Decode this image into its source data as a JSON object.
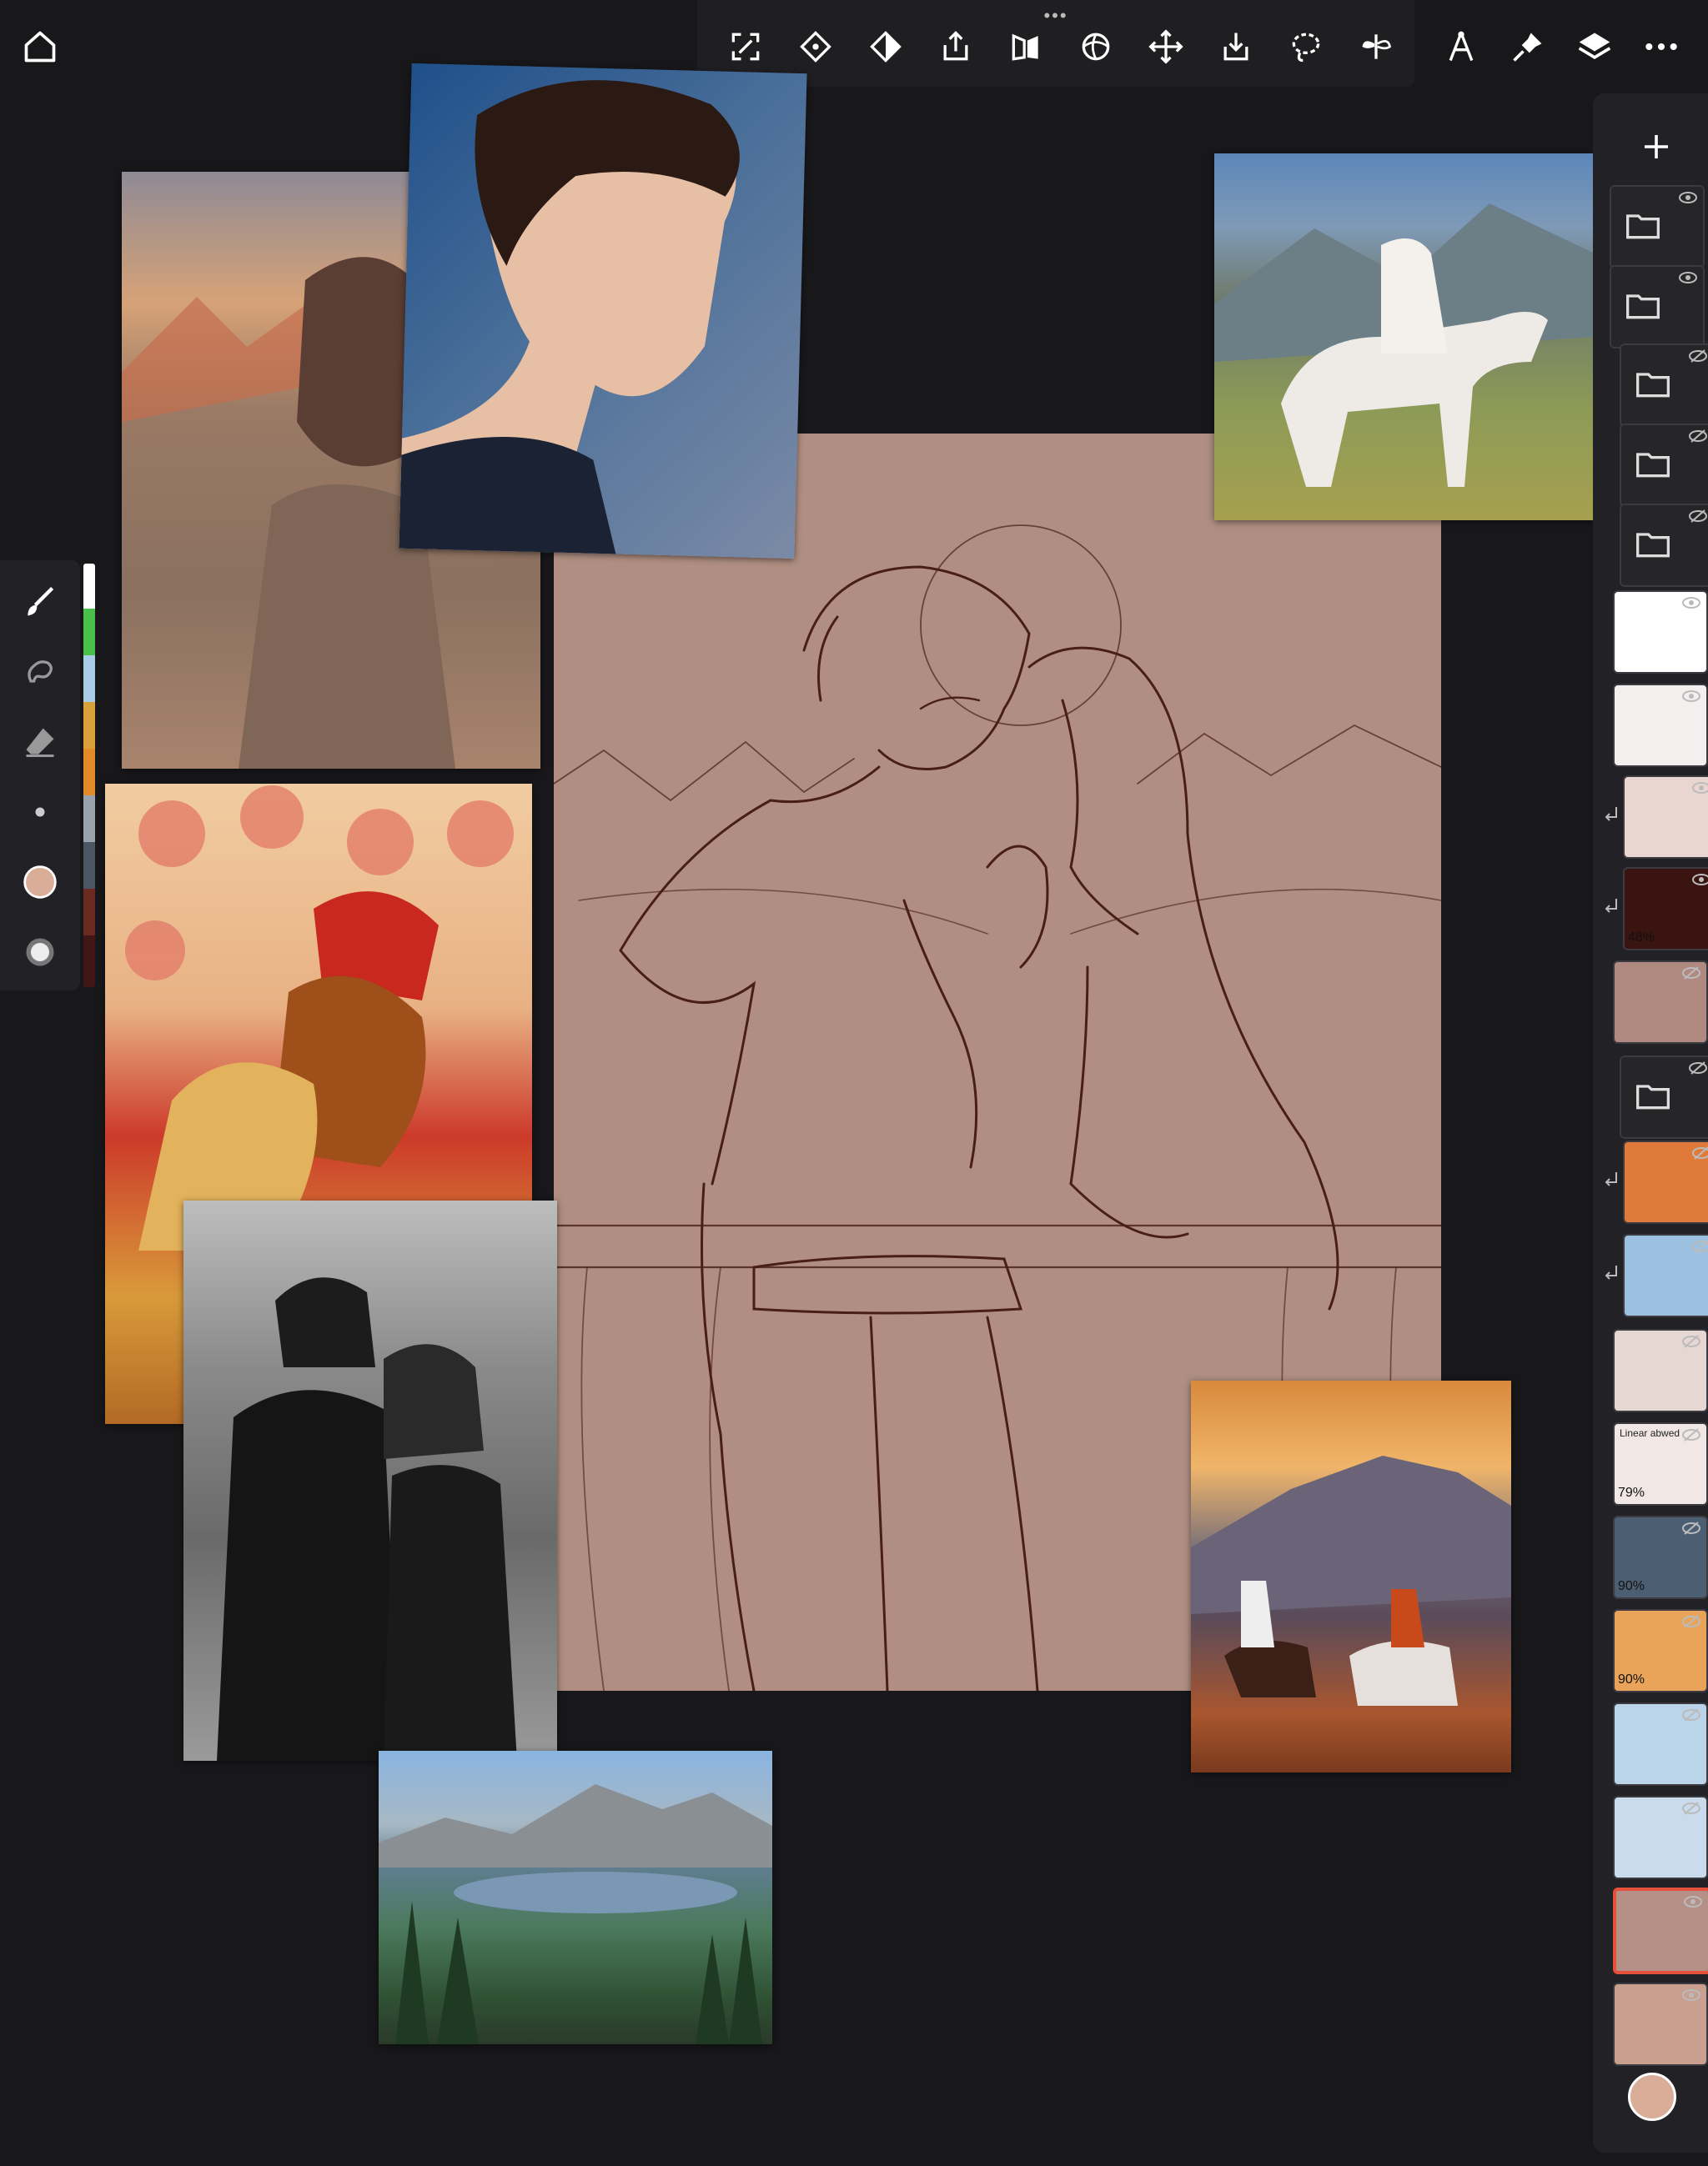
{
  "app": {
    "toolbar_grip": "•••",
    "top_icons": [
      "home-icon",
      "transform-icon",
      "selection-fill-icon",
      "bucket-fill-icon",
      "export-icon",
      "symmetry-icon",
      "perspective-icon",
      "move-icon",
      "import-icon",
      "lasso-icon",
      "mirror-icon",
      "ruler-icon",
      "pin-icon",
      "layers-icon",
      "more-icon"
    ]
  },
  "brush_tools": [
    "brush-icon",
    "smudge-icon",
    "eraser-icon",
    "size-dot-icon",
    "color-swatch-icon",
    "opacity-icon"
  ],
  "swatch_colors": [
    "#ffffff",
    "#48c04a",
    "#a9cde6",
    "#d9a13a",
    "#e08a2a",
    "#9aa3ad",
    "#4a5663",
    "#6b2a20",
    "#401616"
  ],
  "layers": {
    "items": [
      {
        "type": "folder",
        "visible": true
      },
      {
        "type": "folder",
        "visible": true
      },
      {
        "type": "folder",
        "visible": false
      },
      {
        "type": "folder",
        "visible": false
      },
      {
        "type": "folder",
        "visible": false
      },
      {
        "type": "image",
        "visible": true,
        "color": "#ffffff"
      },
      {
        "type": "image",
        "visible": true,
        "color": "#f2efee"
      },
      {
        "type": "image",
        "visible": true,
        "color": "#e9d6d0",
        "clipped": true
      },
      {
        "type": "image",
        "visible": true,
        "color": "#3a1410",
        "opacity": "48%",
        "clipped": true
      },
      {
        "type": "image",
        "visible": false,
        "color": "#b08a80"
      },
      {
        "type": "folder",
        "visible": false
      },
      {
        "type": "image",
        "visible": false,
        "color": "#e07a3a",
        "clipped": true
      },
      {
        "type": "image",
        "visible": false,
        "color": "#9cc0e0",
        "clipped": true
      },
      {
        "type": "image",
        "visible": false,
        "color": "#e7d7d2"
      },
      {
        "type": "image",
        "visible": false,
        "color": "#f1e8e6",
        "mode": "Linear  abwed",
        "opacity": "79%"
      },
      {
        "type": "image",
        "visible": false,
        "color": "#4c5e72",
        "opacity": "90%"
      },
      {
        "type": "image",
        "visible": false,
        "color": "#e9a45a",
        "opacity": "90%"
      },
      {
        "type": "image",
        "visible": false,
        "color": "#bcd4ea"
      },
      {
        "type": "image",
        "visible": false,
        "color": "#c9dbec"
      },
      {
        "type": "image",
        "visible": true,
        "color": "#b59087",
        "selected": true
      },
      {
        "type": "image",
        "visible": true,
        "color": "#c9a090"
      }
    ]
  },
  "current_color": "#d9ad98"
}
